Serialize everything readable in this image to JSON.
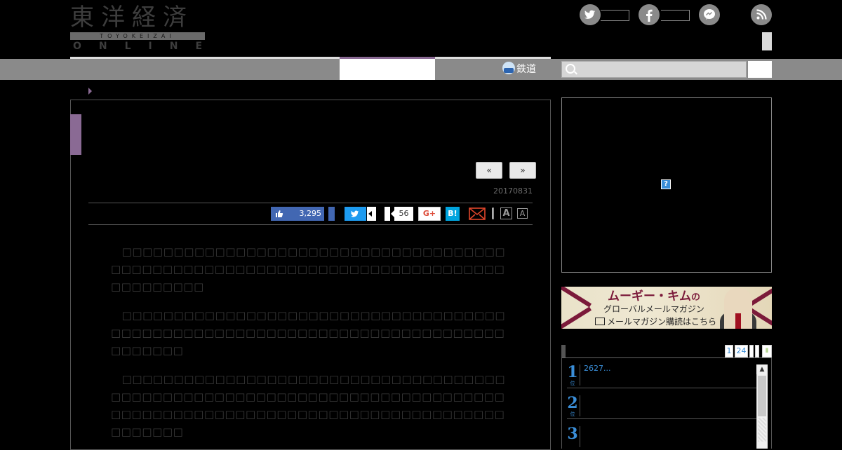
{
  "header": {
    "logo_jp": "東洋経済",
    "logo_band": "TOYOKEIZAI",
    "logo_online": "ONLINE",
    "social": {
      "twitter_icon": "twitter-icon",
      "facebook_icon": "facebook-icon",
      "messenger_icon": "messenger-icon",
      "rss_icon": "rss-icon"
    }
  },
  "nav": {
    "rail_label": "鉄道",
    "search_placeholder": ""
  },
  "article": {
    "prev_label": "«",
    "next_label": "»",
    "date": "20170831",
    "share": {
      "like_count": "3,295",
      "comment_count": "56",
      "gplus_label": "G+",
      "hatena_label": "B!",
      "font_large": "A",
      "font_small": "A"
    },
    "paragraphs": [
      "　□□□□□□□□□□□□□□□□□□□□□□□□□□□□□□□□□□□□□□□□□□□□□□□□□□□□□□□□□□□□□□□□□□□□□□□□□□□□□□□□□□□□",
      "　□□□□□□□□□□□□□□□□□□□□□□□□□□□□□□□□□□□□□□□□□□□□□□□□□□□□□□□□□□□□□□□□□□□□□□□□□□□□□□□□□□",
      "　□□□□□□□□□□□□□□□□□□□□□□□□□□□□□□□□□□□□□□□□□□□□□□□□□□□□□□□□□□□□□□□□□□□□□□□□□□□□□□□□□□□□□□□□□□□□□□□□□□□□□□□□□□□□□□□□□□□□□□□□"
    ]
  },
  "sidebar": {
    "ad_marker": "?",
    "banner": {
      "title_main": "ムーギー・キム",
      "title_suffix": "の",
      "subtitle": "グローバルメールマガジン",
      "cta": "メールマガジン購読はこちら"
    },
    "ranking": {
      "tab_1": "1",
      "tab_24": "24",
      "items": [
        {
          "rank": "1",
          "text": "2627..."
        },
        {
          "rank": "2",
          "text": ""
        },
        {
          "rank": "3",
          "text": ""
        }
      ]
    }
  }
}
